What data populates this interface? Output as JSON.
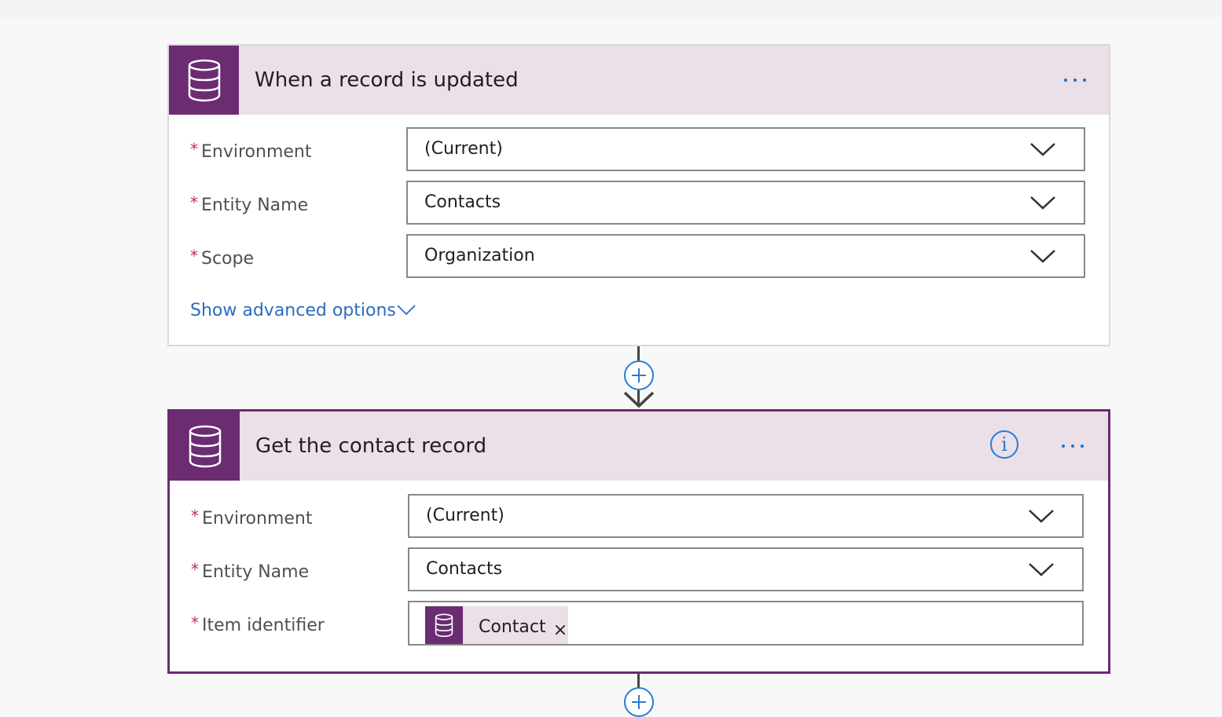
{
  "colors": {
    "brand": "#6b2c72",
    "header_bg": "#ebdfe8",
    "link": "#2b6cc0",
    "required": "#c4314b",
    "connector": "#444444"
  },
  "steps": [
    {
      "title": "When a record is updated",
      "icon": "database-icon",
      "fields": [
        {
          "label": "Environment",
          "required_mark": "*",
          "value": "(Current)"
        },
        {
          "label": "Entity Name",
          "required_mark": "*",
          "value": "Contacts"
        },
        {
          "label": "Scope",
          "required_mark": "*",
          "value": "Organization"
        }
      ],
      "advanced_link": "Show advanced options"
    },
    {
      "title": "Get the contact record",
      "icon": "database-icon",
      "fields": [
        {
          "label": "Environment",
          "required_mark": "*",
          "value": "(Current)"
        },
        {
          "label": "Entity Name",
          "required_mark": "*",
          "value": "Contacts"
        },
        {
          "label": "Item identifier",
          "required_mark": "*",
          "token": {
            "label": "Contact",
            "remove": "×"
          }
        }
      ]
    }
  ]
}
